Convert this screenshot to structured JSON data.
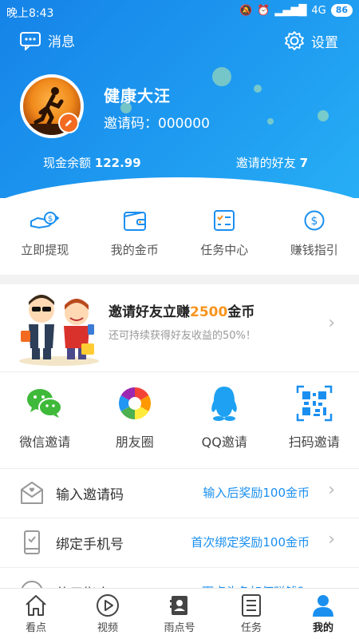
{
  "status_bar": {
    "time": "晚上8:43",
    "network": "4G",
    "battery": "86"
  },
  "header": {
    "message_label": "消息",
    "settings_label": "设置",
    "username": "健康大汪",
    "invite_code": "邀请码：000000",
    "cash_label": "现金余额",
    "cash_value": "122.99",
    "friends_label": "邀请的好友",
    "friends_value": "7"
  },
  "quick_actions": [
    {
      "label": "立即提现",
      "icon": "withdraw-icon"
    },
    {
      "label": "我的金币",
      "icon": "wallet-icon"
    },
    {
      "label": "任务中心",
      "icon": "checklist-icon"
    },
    {
      "label": "赚钱指引",
      "icon": "dollar-circle-icon"
    }
  ],
  "banner": {
    "title_prefix": "邀请好友立赚",
    "title_highlight": "2500",
    "title_suffix": "金币",
    "subtitle": "还可持续获得好友收益的50%！"
  },
  "share": [
    {
      "label": "微信邀请",
      "icon": "wechat-icon"
    },
    {
      "label": "朋友圈",
      "icon": "moments-icon"
    },
    {
      "label": "QQ邀请",
      "icon": "qq-icon"
    },
    {
      "label": "扫码邀请",
      "icon": "qrcode-icon"
    }
  ],
  "rows": [
    {
      "title": "输入邀请码",
      "value": "输入后奖励100金币",
      "icon": "envelope-icon"
    },
    {
      "title": "绑定手机号",
      "value": "首次绑定奖励100金币",
      "icon": "phone-icon"
    },
    {
      "title": "使用指南",
      "value": "雨点头条如何赚钱？",
      "icon": "guide-icon"
    }
  ],
  "tabs": [
    {
      "label": "看点",
      "icon": "home-icon"
    },
    {
      "label": "视频",
      "icon": "play-icon"
    },
    {
      "label": "雨点号",
      "icon": "profile-card-icon"
    },
    {
      "label": "任务",
      "icon": "task-list-icon"
    },
    {
      "label": "我的",
      "icon": "user-icon",
      "active": true
    }
  ],
  "colors": {
    "primary": "#1a8ff0",
    "highlight": "#f7941d",
    "accent_orange": "#f26b21"
  }
}
